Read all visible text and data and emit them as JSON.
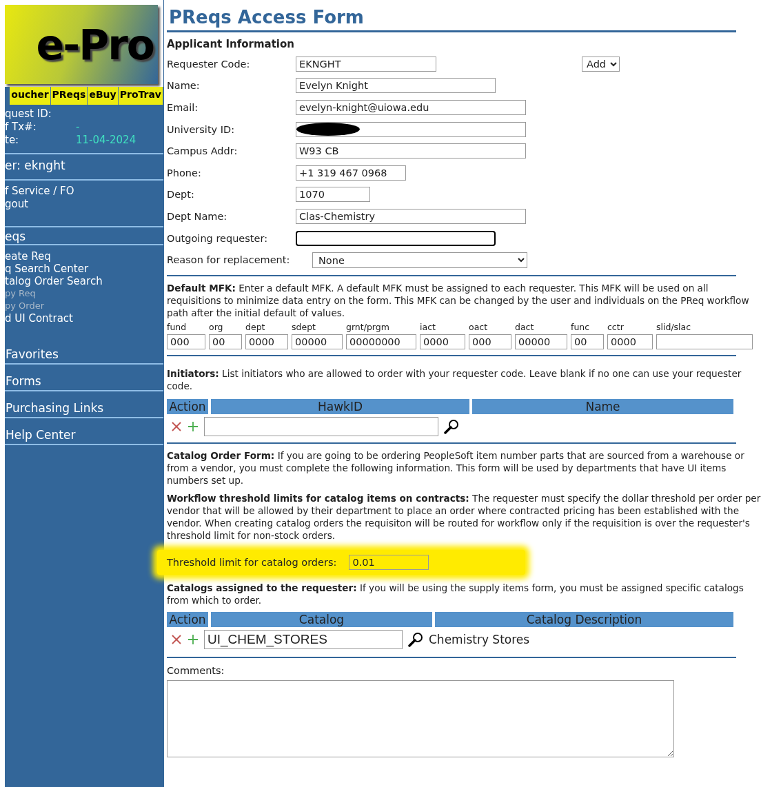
{
  "sidebar": {
    "logo": "e-Pro",
    "tabs": [
      "oucher",
      "PReqs",
      "eBuy",
      "ProTrav"
    ],
    "info": [
      {
        "label": "quest ID:"
      },
      {
        "label": "f Tx#:",
        "value": "-"
      },
      {
        "label": "te:",
        "value": "11-04-2024"
      }
    ],
    "user": "er: eknght",
    "account_links": [
      "f Service / FO",
      "gout"
    ],
    "preqs_heading": "eqs",
    "preqs_links": [
      {
        "label": "eate Req",
        "disabled": false
      },
      {
        "label": "q Search Center",
        "disabled": false
      },
      {
        "label": "talog Order Search",
        "disabled": false
      },
      {
        "label": "py Req",
        "disabled": true
      },
      {
        "label": "py Order",
        "disabled": true
      },
      {
        "label": "d UI Contract",
        "disabled": false
      }
    ],
    "sections": [
      "Favorites",
      "Forms",
      "Purchasing Links",
      "Help Center"
    ]
  },
  "form": {
    "title": "PReqs Access Form",
    "applicant": {
      "heading": "Applicant Information",
      "action_select": "Add",
      "fields": [
        {
          "label": "Requester Code:",
          "value": "EKNGHT",
          "kind": "text",
          "focused": false
        },
        {
          "label": "Name:",
          "value": "Evelyn Knight",
          "kind": "text",
          "focused": false
        },
        {
          "label": "Email:",
          "value": "evelyn-knight@uiowa.edu",
          "kind": "text",
          "focused": false
        },
        {
          "label": "University ID:",
          "kind": "redacted",
          "focused": false
        },
        {
          "label": "Campus Addr:",
          "value": "W93 CB",
          "kind": "text",
          "focused": false
        },
        {
          "label": "Phone:",
          "value": "+1 319 467 0968",
          "kind": "text",
          "focused": false
        },
        {
          "label": "Dept:",
          "value": "1070",
          "kind": "text",
          "focused": false
        },
        {
          "label": "Dept Name:",
          "value": "Clas-Chemistry",
          "kind": "text",
          "focused": false
        },
        {
          "label": "Outgoing requester:",
          "kind": "text",
          "focused": true
        },
        {
          "label": "Reason for replacement:",
          "value": "None",
          "kind": "select",
          "focused": false
        }
      ]
    },
    "mfk": {
      "text": "**Default MFK:** Enter a default MFK. A default MFK must be assigned to each requester. This MFK will be used on all requisitions to minimize data entry on the form. This MFK can be changed by the user and individuals on the PReq workflow path after the initial default of values.",
      "columns": [
        {
          "label": "fund",
          "value": "000"
        },
        {
          "label": "org",
          "value": "00"
        },
        {
          "label": "dept",
          "value": "0000"
        },
        {
          "label": "sdept",
          "value": "00000"
        },
        {
          "label": "grnt/prgm",
          "value": "00000000"
        },
        {
          "label": "iact",
          "value": "0000"
        },
        {
          "label": "oact",
          "value": "000"
        },
        {
          "label": "dact",
          "value": "00000"
        },
        {
          "label": "func",
          "value": "00"
        },
        {
          "label": "cctr",
          "value": "0000"
        },
        {
          "label": "slid/slac"
        }
      ]
    },
    "initiators": {
      "text": "**Initiators:** List initiators who are allowed to order with your requester code. Leave blank if no one can use your requester code.",
      "columns": [
        "Action",
        "HawkID",
        "Name"
      ]
    },
    "catalog": {
      "paragraphs": [
        "**Catalog Order Form:** If you are going to be ordering PeopleSoft item number parts that are sourced from a warehouse or from a vendor, you must complete the following information. This form will be used by departments that have UI items numbers set up.",
        "**Workflow threshold limits for catalog items on contracts:** The requester must specify the dollar threshold per order per vendor that will be allowed by their department to place an order where contracted pricing has been established with the vendor. When creating catalog orders the requisiton will be routed for workflow only if the requisition is over the requester's threshold limit for non-stock orders."
      ],
      "threshold": {
        "label": "Threshold limit for catalog orders:",
        "value": "0.01",
        "highlighted": true
      },
      "assigned_text": "**Catalogs assigned to the requester:** If you will be using the supply items form, you must be assigned specific catalogs from which to order.",
      "columns": [
        "Action",
        "Catalog",
        "Catalog Description"
      ],
      "rows": [
        {
          "catalog": "UI_CHEM_STORES",
          "description": "Chemistry Stores"
        }
      ]
    },
    "comments_label": "Comments:"
  }
}
